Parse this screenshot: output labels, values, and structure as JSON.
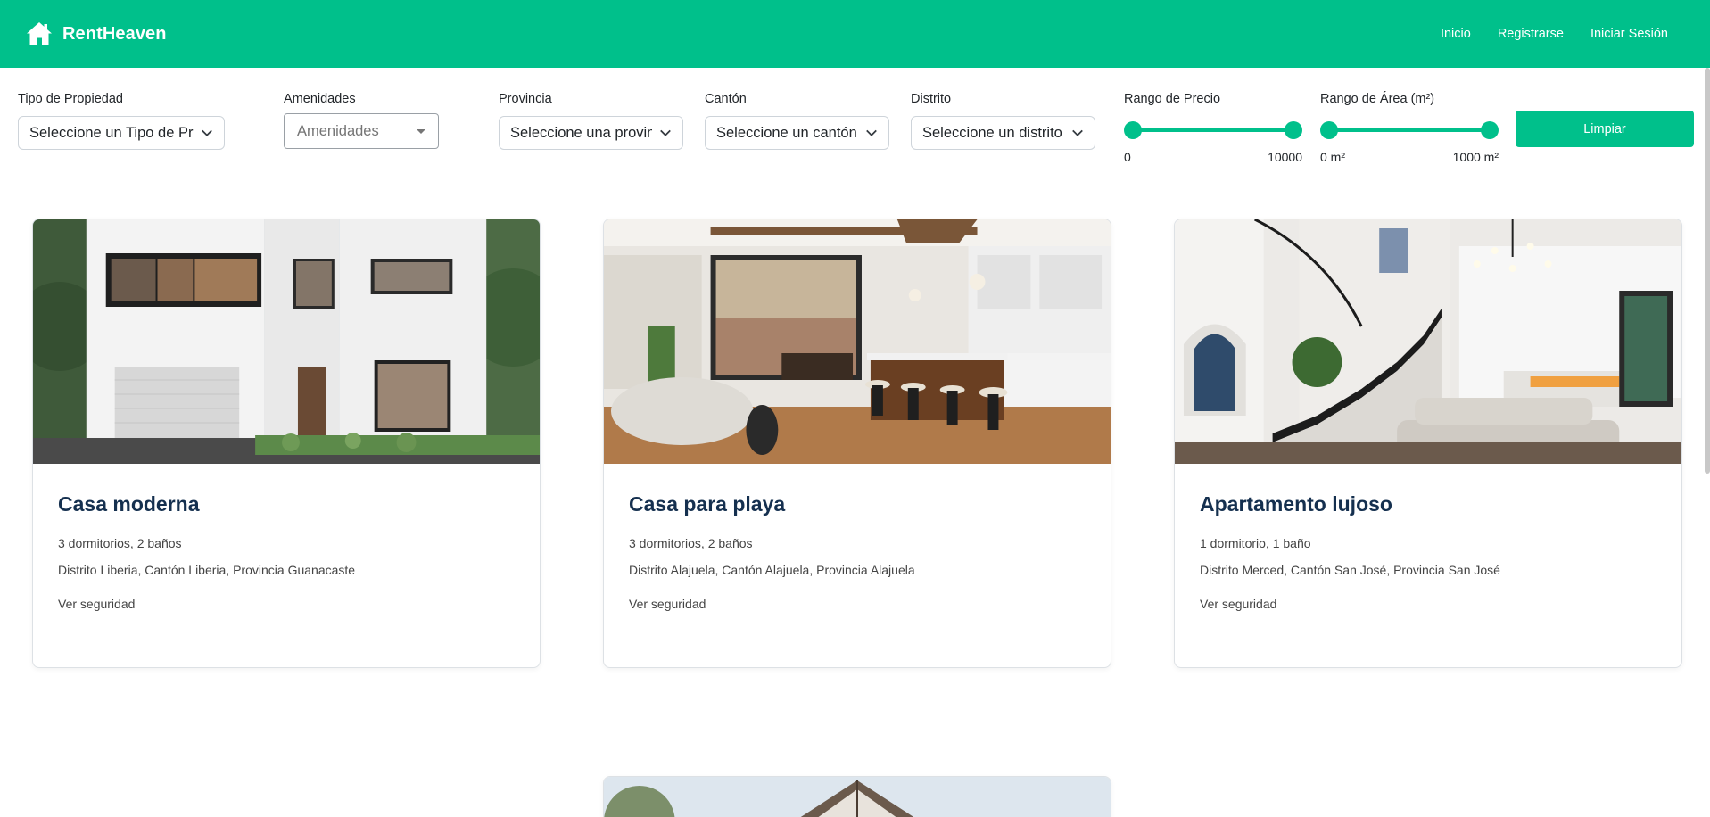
{
  "navbar": {
    "brand": "RentHeaven",
    "links": [
      "Inicio",
      "Registrarse",
      "Iniciar Sesión"
    ]
  },
  "filters": {
    "tipo": {
      "label": "Tipo de Propiedad",
      "value": "Seleccione un Tipo de Pro"
    },
    "amenidades": {
      "label": "Amenidades",
      "value": "Amenidades"
    },
    "provincia": {
      "label": "Provincia",
      "value": "Seleccione una provincia"
    },
    "canton": {
      "label": "Cantón",
      "value": "Seleccione un cantón"
    },
    "distrito": {
      "label": "Distrito",
      "value": "Seleccione un distrito"
    },
    "precio": {
      "label": "Rango de Precio",
      "min": "0",
      "max": "10000"
    },
    "area": {
      "label": "Rango de Área (m²)",
      "min": "0 m²",
      "max": "1000 m²"
    },
    "clear_label": "Limpiar"
  },
  "cards": [
    {
      "title": "Casa moderna",
      "rooms": "3 dormitorios, 2 baños",
      "location": "Distrito Liberia, Cantón Liberia, Provincia Guanacaste",
      "link": "Ver seguridad"
    },
    {
      "title": "Casa para playa",
      "rooms": "3 dormitorios, 2 baños",
      "location": "Distrito Alajuela, Cantón Alajuela, Provincia Alajuela",
      "link": "Ver seguridad"
    },
    {
      "title": "Apartamento lujoso",
      "rooms": "1 dormitorio, 1 baño",
      "location": "Distrito Merced, Cantón San José, Provincia San José",
      "link": "Ver seguridad"
    }
  ],
  "colors": {
    "brand": "#00c08b",
    "title": "#15304f"
  }
}
